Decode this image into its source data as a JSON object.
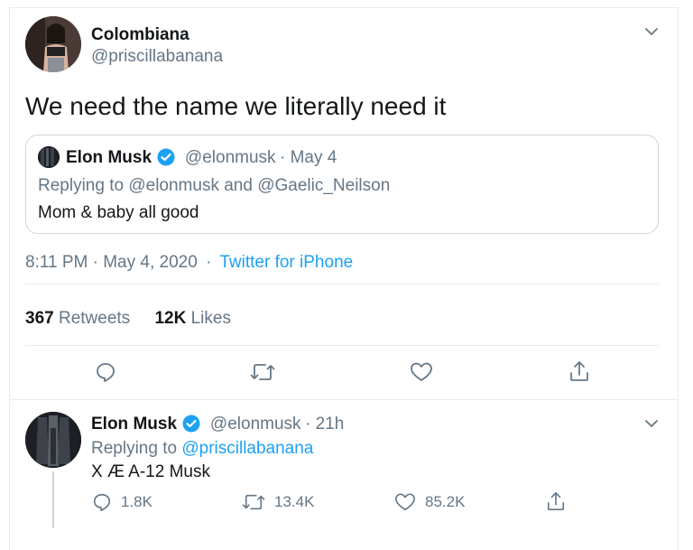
{
  "tweet": {
    "author_name": "Colombiana",
    "author_handle": "@priscillabanana",
    "text": "We need the name we literally need it",
    "quoted": {
      "author_name": "Elon Musk",
      "author_handle": "@elonmusk",
      "date": "· May 4",
      "replying_prefix": "Replying to ",
      "replying_to": "@elonmusk and @Gaelic_Neilson",
      "text": "Mom & baby all good"
    },
    "meta": {
      "time": "8:11 PM · May 4, 2020",
      "sep": "·",
      "source": "Twitter for iPhone"
    },
    "stats": {
      "retweets_count": "367",
      "retweets_label": "Retweets",
      "likes_count": "12K",
      "likes_label": "Likes"
    }
  },
  "reply": {
    "author_name": "Elon Musk",
    "author_handle": "@elonmusk",
    "time": "· 21h",
    "replying_prefix": "Replying to ",
    "replying_to": "@priscillabanana",
    "text": "X Æ A-12 Musk",
    "actions": {
      "replies": "1.8K",
      "retweets": "13.4K",
      "likes": "85.2K"
    }
  },
  "colors": {
    "accent": "#1da1f2",
    "muted": "#657786",
    "border": "#e6ecf0"
  },
  "icons": [
    "chevron-down-icon",
    "verified-icon",
    "reply-icon",
    "retweet-icon",
    "like-icon",
    "share-icon"
  ]
}
